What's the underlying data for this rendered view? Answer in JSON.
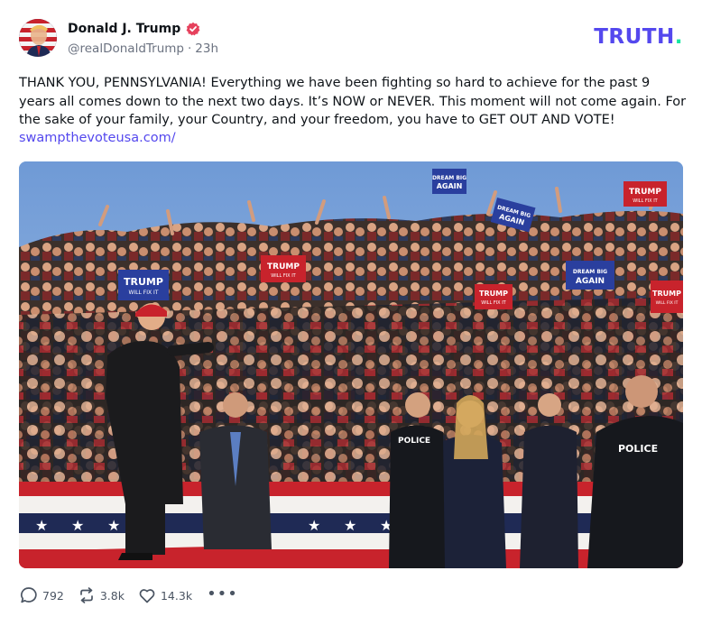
{
  "author": {
    "display_name": "Donald J. Trump",
    "handle": "@realDonaldTrump",
    "time_ago": "23h"
  },
  "brand": {
    "logo_text": "TRUTH",
    "logo_dot": ".",
    "logo_color": "#5448ee",
    "dot_color": "#17e6a2"
  },
  "post": {
    "text": "THANK YOU, PENNSYLVANIA! Everything we have been fighting so hard to achieve for the past 9 years all comes down to the next two days. It’s NOW or NEVER. This moment will not come again. For the sake of your family, your Country, and your freedom, you have to GET OUT AND VOTE!",
    "link": "swampthevoteusa.com/"
  },
  "media": {
    "signs": [
      {
        "line1": "DREAM BIG",
        "line2": "AGAIN",
        "color": "#2a3f9e"
      },
      {
        "line1": "TRUMP",
        "line2": "WILL FIX IT",
        "color": "#c8232c"
      },
      {
        "line1": "TRUMP",
        "line2": "WILL FIX IT",
        "color": "#2a3f9e"
      },
      {
        "line1": "TRUMP",
        "line2": "WILL FIX IT",
        "color": "#c8232c"
      },
      {
        "line1": "DREAM BIG",
        "line2": "AGAIN",
        "color": "#2a3f9e"
      },
      {
        "line1": "TRUMP",
        "line2": "WILL FIX IT",
        "color": "#c8232c"
      },
      {
        "line1": "TRUMP",
        "line2": "WILL FIX IT",
        "color": "#c8232c"
      },
      {
        "line1": "DREAM BIG",
        "line2": "AGAIN",
        "color": "#2a3f9e"
      }
    ],
    "police_left": "POLICE",
    "police_right": "POLICE"
  },
  "actions": {
    "replies": "792",
    "retruths": "3.8k",
    "likes": "14.3k",
    "more": "•••"
  },
  "icons": {
    "verified": "verified-badge-icon",
    "reply": "speech-bubble-icon",
    "retruth": "retruth-arrows-icon",
    "like": "heart-icon",
    "more": "ellipsis-icon"
  }
}
